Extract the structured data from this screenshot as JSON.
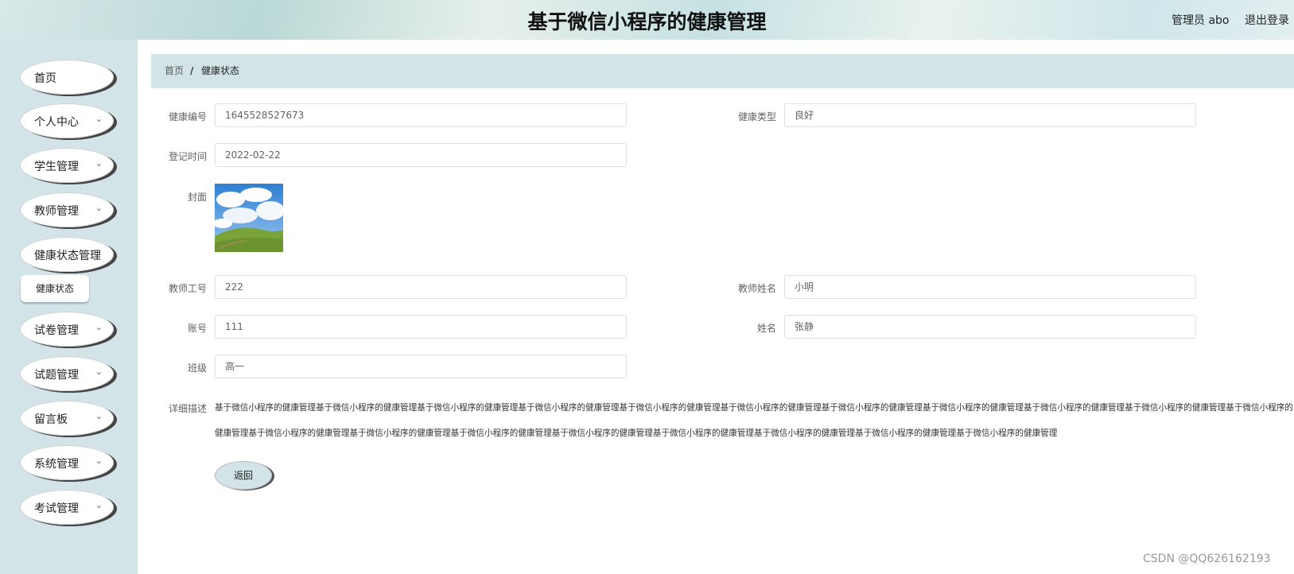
{
  "header": {
    "title": "基于微信小程序的健康管理",
    "user": "管理员 abo",
    "logout": "退出登录"
  },
  "sidebar": {
    "items": [
      {
        "label": "首页",
        "has_chevron": false
      },
      {
        "label": "个人中心",
        "has_chevron": true
      },
      {
        "label": "学生管理",
        "has_chevron": true
      },
      {
        "label": "教师管理",
        "has_chevron": true
      },
      {
        "label": "健康状态管理",
        "has_chevron": false
      },
      {
        "label": "试卷管理",
        "has_chevron": true
      },
      {
        "label": "试题管理",
        "has_chevron": true
      },
      {
        "label": "留言板",
        "has_chevron": true
      },
      {
        "label": "系统管理",
        "has_chevron": true
      },
      {
        "label": "考试管理",
        "has_chevron": true
      }
    ],
    "sub_item": "健康状态"
  },
  "breadcrumb": {
    "home": "首页",
    "separator": "/",
    "current": "健康状态"
  },
  "form": {
    "health_no_label": "健康编号",
    "health_no": "1645528527673",
    "health_type_label": "健康类型",
    "health_type": "良好",
    "reg_time_label": "登记时间",
    "reg_time": "2022-02-22",
    "cover_label": "封面",
    "teacher_no_label": "教师工号",
    "teacher_no": "222",
    "teacher_name_label": "教师姓名",
    "teacher_name": "小明",
    "account_label": "账号",
    "account": "111",
    "name_label": "姓名",
    "name": "张静",
    "class_label": "班级",
    "class": "高一",
    "desc_label": "详细描述",
    "desc": "基于微信小程序的健康管理基于微信小程序的健康管理基于微信小程序的健康管理基于微信小程序的健康管理基于微信小程序的健康管理基于微信小程序的健康管理基于微信小程序的健康管理基于微信小程序的健康管理基于微信小程序的健康管理基于微信小程序的健康管理基于微信小程序的健康管理基于微信小程序的健康管理基于微信小程序的健康管理基于微信小程序的健康管理基于微信小程序的健康管理基于微信小程序的健康管理基于微信小程序的健康管理基于微信小程序的健康管理基于微信小程序的健康管理",
    "back_button": "返回"
  },
  "watermark": "CSDN @QQ626162193",
  "icons": {
    "chevron": "chevron-down-icon",
    "cursor": "hand-cursor-icon"
  },
  "colors": {
    "sidebar_bg": "#d3e4e8",
    "breadcrumb_bg": "#d3e4e8"
  }
}
